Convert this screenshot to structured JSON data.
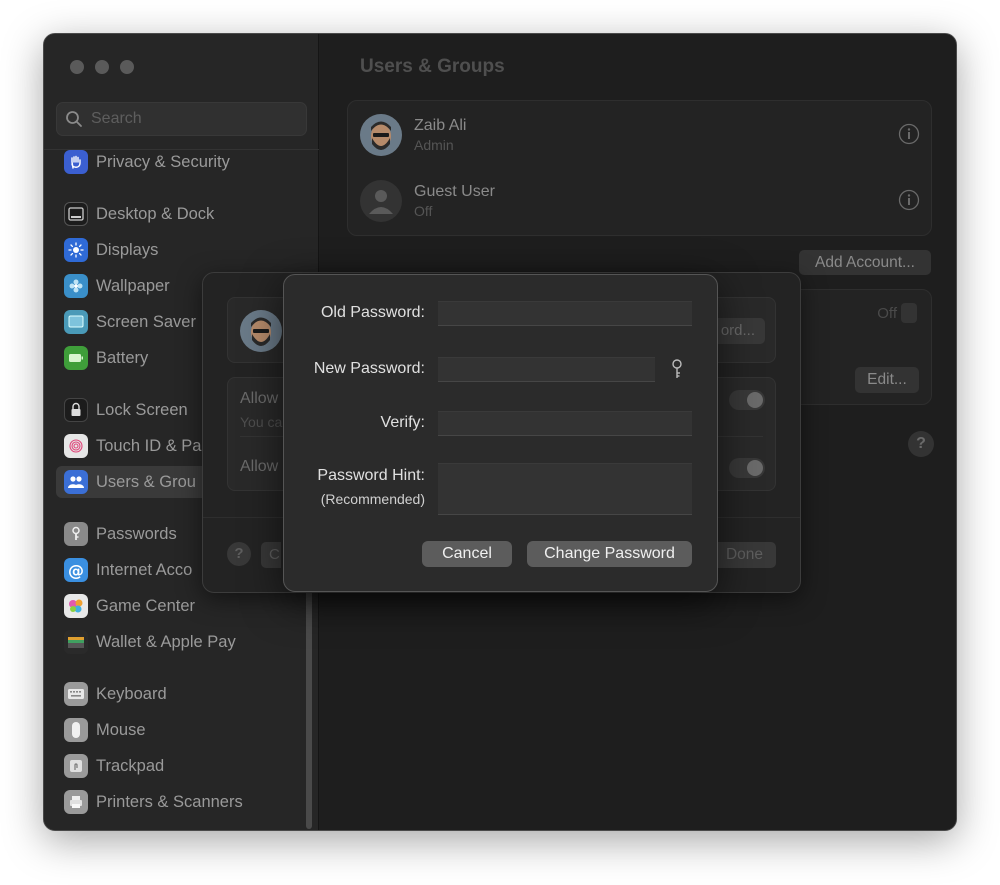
{
  "window": {
    "traffic_lights": [
      "close",
      "minimize",
      "zoom"
    ]
  },
  "search": {
    "placeholder": "Search"
  },
  "sidebar": {
    "items": [
      {
        "label": "Privacy & Security",
        "icon": "hand-icon",
        "color": "#3b5fd0"
      },
      {
        "label": "Desktop & Dock",
        "icon": "dock-icon",
        "color": "#1c1c1c"
      },
      {
        "label": "Displays",
        "icon": "sun-icon",
        "color": "#2f6ad6"
      },
      {
        "label": "Wallpaper",
        "icon": "flower-icon",
        "color": "#3a8fc9"
      },
      {
        "label": "Screen Saver",
        "icon": "screen-saver-icon",
        "color": "#4a9ab8"
      },
      {
        "label": "Battery",
        "icon": "battery-icon",
        "color": "#3f9e3a"
      },
      {
        "label": "Lock Screen",
        "icon": "lock-icon",
        "color": "#1c1c1c"
      },
      {
        "label": "Touch ID & Pa",
        "icon": "fingerprint-icon",
        "color": "#ffffff"
      },
      {
        "label": "Users & Grou",
        "icon": "users-icon",
        "color": "#3b6fd6"
      },
      {
        "label": "Passwords",
        "icon": "key-icon",
        "color": "#8a8a8a"
      },
      {
        "label": "Internet Acco",
        "icon": "at-icon",
        "color": "#3a8fe0"
      },
      {
        "label": "Game Center",
        "icon": "game-center-icon",
        "color": "#c06ad0"
      },
      {
        "label": "Wallet & Apple Pay",
        "icon": "wallet-icon",
        "color": "#2a2a2a"
      },
      {
        "label": "Keyboard",
        "icon": "keyboard-icon",
        "color": "#9a9a9a"
      },
      {
        "label": "Mouse",
        "icon": "mouse-icon",
        "color": "#9a9a9a"
      },
      {
        "label": "Trackpad",
        "icon": "trackpad-icon",
        "color": "#9a9a9a"
      },
      {
        "label": "Printers & Scanners",
        "icon": "printer-icon",
        "color": "#9a9a9a"
      }
    ]
  },
  "main": {
    "title": "Users & Groups",
    "users": [
      {
        "name": "Zaib Ali",
        "role": "Admin"
      },
      {
        "name": "Guest User",
        "role": "Off"
      }
    ],
    "add_account_label": "Add Account...",
    "auto_login_value": "Off",
    "edit_label": "Edit...",
    "help_label": "?"
  },
  "sheet": {
    "password_button_label": "ord...",
    "allow_label_1": "Allow",
    "allow_sub_1": "You ca",
    "allow_label_2": "Allow",
    "help_label": "?",
    "cancel_partial": "C",
    "done_label": "Done"
  },
  "dialog": {
    "old_password_label": "Old Password:",
    "new_password_label": "New Password:",
    "verify_label": "Verify:",
    "hint_label": "Password Hint:",
    "hint_sub": "(Recommended)",
    "old_password_value": "",
    "new_password_value": "",
    "verify_value": "",
    "hint_value": "",
    "cancel_label": "Cancel",
    "change_label": "Change Password"
  }
}
